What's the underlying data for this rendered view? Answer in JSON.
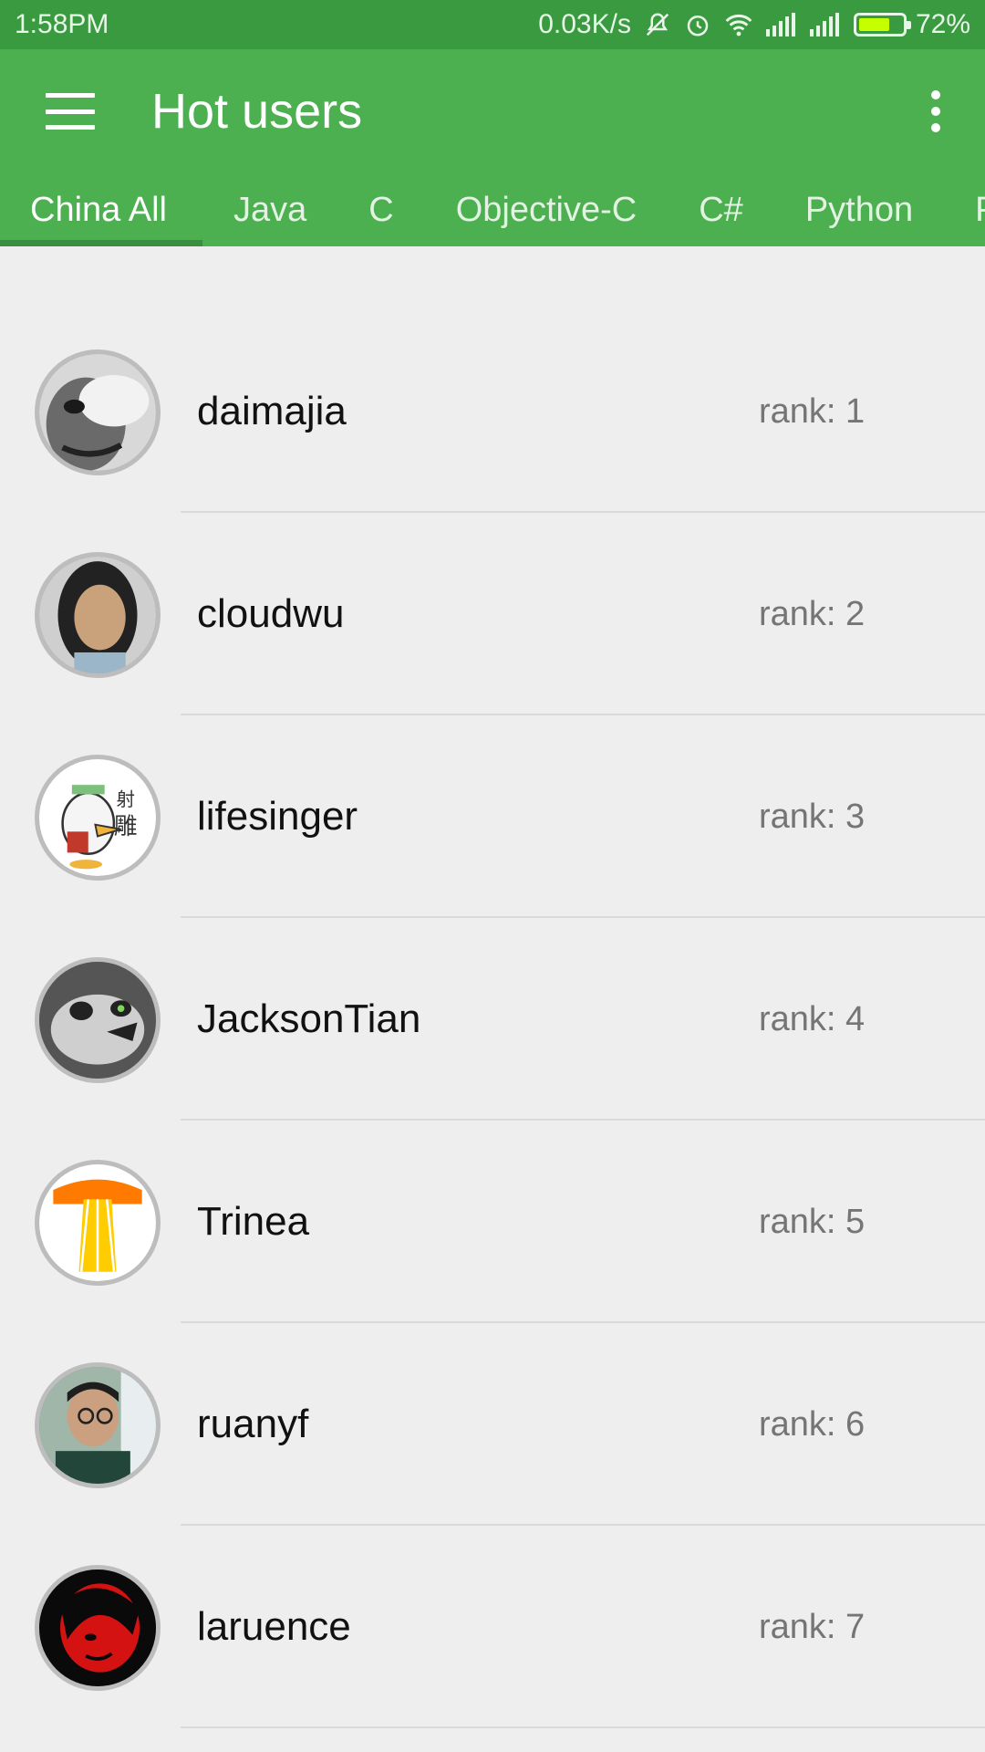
{
  "status_bar": {
    "time": "1:58PM",
    "net_speed": "0.03K/s",
    "battery_percent": "72%",
    "battery_level": 0.72,
    "icons": [
      "mute-icon",
      "alarm-icon",
      "wifi-icon",
      "signal-icon",
      "signal-icon",
      "battery-icon"
    ]
  },
  "toolbar": {
    "title": "Hot users",
    "color": "#4caf50",
    "status_color": "#3a9a3f"
  },
  "tabs": [
    {
      "label": "China All",
      "active": true
    },
    {
      "label": "Java"
    },
    {
      "label": "C"
    },
    {
      "label": "Objective-C"
    },
    {
      "label": "C#"
    },
    {
      "label": "Python"
    },
    {
      "label": "P"
    }
  ],
  "users": [
    {
      "name": "daimajia",
      "rank": "rank: 1"
    },
    {
      "name": "cloudwu",
      "rank": "rank: 2"
    },
    {
      "name": "lifesinger",
      "rank": "rank: 3"
    },
    {
      "name": "JacksonTian",
      "rank": "rank: 4"
    },
    {
      "name": "Trinea",
      "rank": "rank: 5"
    },
    {
      "name": "ruanyf",
      "rank": "rank: 6"
    },
    {
      "name": "laruence",
      "rank": "rank: 7"
    }
  ]
}
